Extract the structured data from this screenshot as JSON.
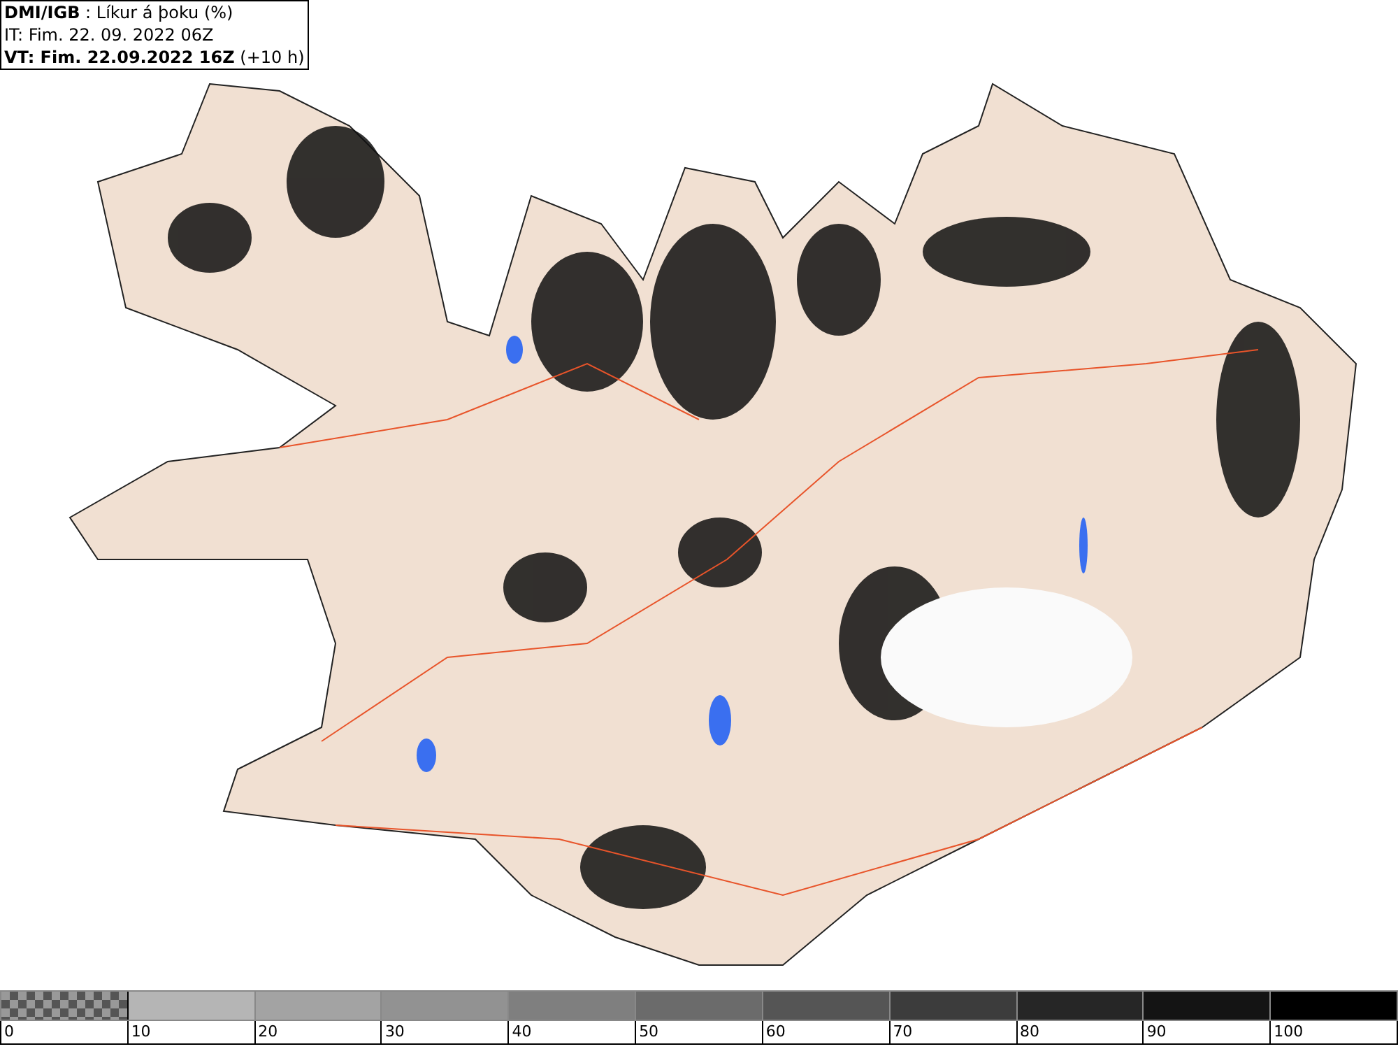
{
  "header": {
    "lines": [
      "**DMI/IGB** : Líkur á þoku (%)",
      "IT: Fim. 22. 09. 2022 06Z",
      "**VT: Fim. 22.09.2022 16Z** (+10 h)"
    ]
  },
  "colorbar": {
    "segments": [
      {
        "kind": "checkered"
      },
      {
        "kind": "solid",
        "color": "#b5b5b5"
      },
      {
        "kind": "solid",
        "color": "#a3a3a3"
      },
      {
        "kind": "solid",
        "color": "#929292"
      },
      {
        "kind": "solid",
        "color": "#7f7f7f"
      },
      {
        "kind": "solid",
        "color": "#6b6b6b"
      },
      {
        "kind": "solid",
        "color": "#555555"
      },
      {
        "kind": "solid",
        "color": "#3c3c3c"
      },
      {
        "kind": "solid",
        "color": "#262626"
      },
      {
        "kind": "solid",
        "color": "#141414"
      },
      {
        "kind": "solid",
        "color": "#000000"
      }
    ],
    "tick_labels": [
      "0",
      "10",
      "20",
      "30",
      "40",
      "50",
      "60",
      "70",
      "80",
      "90",
      "100"
    ]
  }
}
